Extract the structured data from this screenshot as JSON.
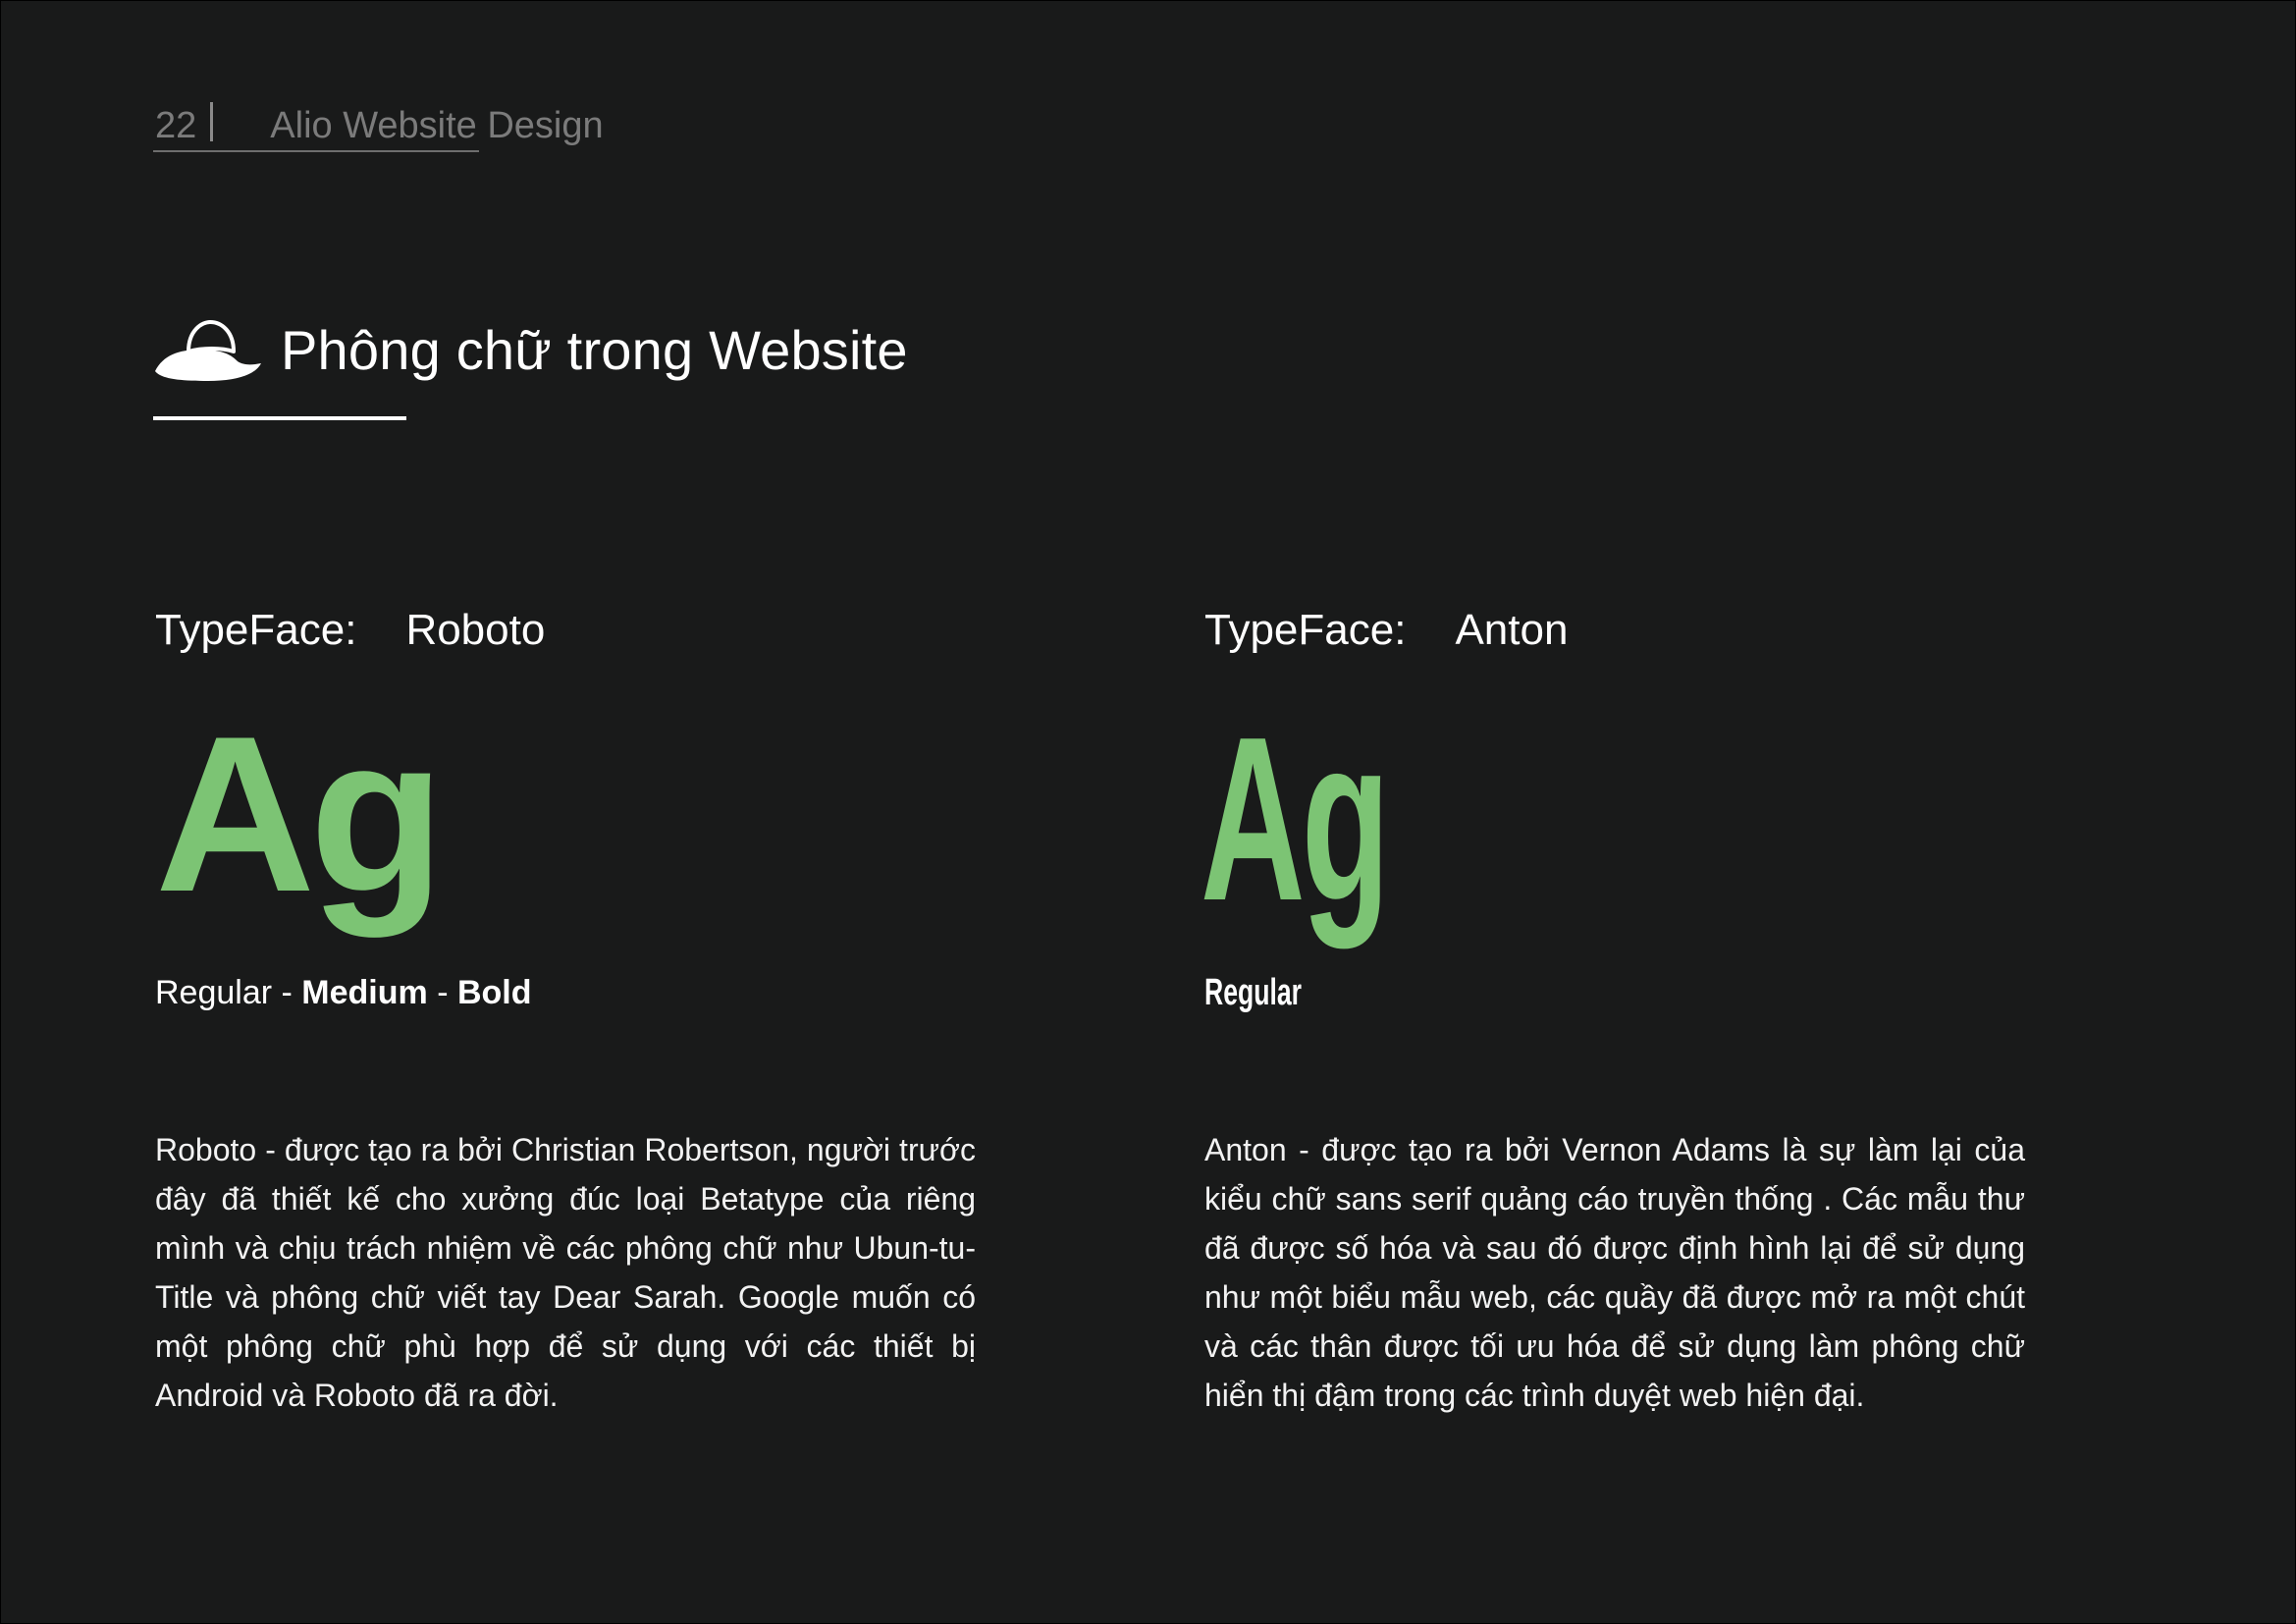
{
  "header": {
    "page_number": "22",
    "doc_title": "Alio Website Design"
  },
  "section": {
    "icon": "hat-icon",
    "title": "Phông chữ trong Website"
  },
  "typefaces": [
    {
      "label": "TypeFace:",
      "name": "Roboto",
      "specimen": "Ag",
      "weights": [
        "Regular",
        "Medium",
        "Bold"
      ],
      "separator": " - ",
      "description": "Roboto - được tạo ra bởi Christian Robertson, người trước đây đã thiết kế cho xưởng đúc loại Betatype của riêng mình và chịu trách nhiệm về các phông chữ như Ubun-tu-Title và phông chữ viết tay Dear Sarah. Google muốn có một phông chữ phù hợp để sử dụng với các thiết bị Android và Roboto đã ra đời."
    },
    {
      "label": "TypeFace:",
      "name": "Anton",
      "specimen": "Ag",
      "weights": [
        "Regular"
      ],
      "description": "Anton - được tạo ra bởi Vernon Adams là sự làm lại của kiểu chữ sans serif quảng cáo truyền thống . Các mẫu thư đã được số hóa và sau đó được định hình lại để sử dụng như một biểu mẫu web, các quầy đã được mở ra một chút và các thân được tối ưu hóa để sử dụng làm phông chữ hiển thị đậm trong các trình duyệt web hiện đại."
    }
  ],
  "colors": {
    "background": "#191a1a",
    "accent_green": "#7cc474",
    "muted_text": "#7b7b7b",
    "text": "#ffffff"
  }
}
